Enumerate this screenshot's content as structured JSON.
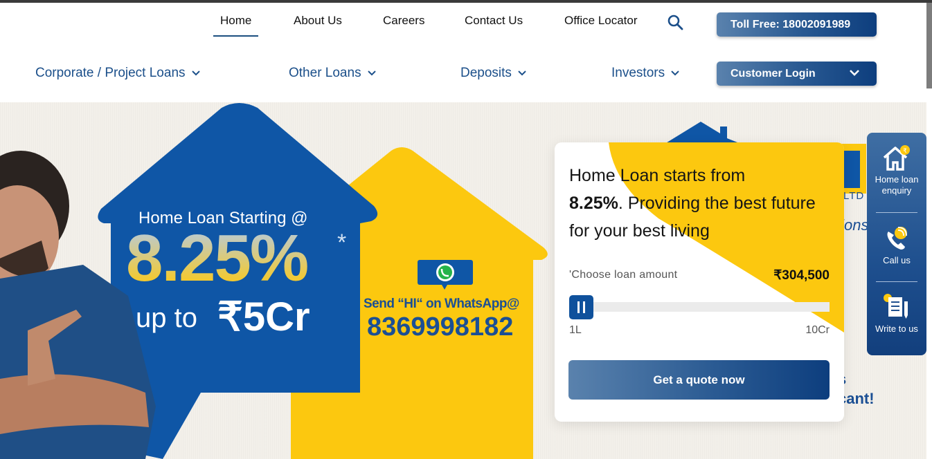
{
  "header": {
    "top_nav": [
      {
        "label": "Home",
        "active": true
      },
      {
        "label": "About Us",
        "active": false
      },
      {
        "label": "Careers",
        "active": false
      },
      {
        "label": "Contact Us",
        "active": false
      },
      {
        "label": "Office Locator",
        "active": false
      }
    ],
    "search_icon": "search-icon",
    "toll_free_label": "Toll Free: 18002091989",
    "main_nav": [
      {
        "label": "Corporate / Project Loans",
        "icon": "chevron-down-icon"
      },
      {
        "label": "Other Loans",
        "icon": "chevron-down-icon"
      },
      {
        "label": "Deposits",
        "icon": "chevron-down-icon"
      },
      {
        "label": "Investors",
        "icon": "chevron-down-icon"
      }
    ],
    "customer_login_label": "Customer Login"
  },
  "hero": {
    "headline": "Home Loan Starting @",
    "rate": "8.25%",
    "rate_footnote": "*",
    "upto_label": "up to",
    "upto_amount": "₹5Cr",
    "whatsapp_text": "Send “HI“ on WhatsApp@",
    "whatsapp_number": "8369998182",
    "brand_suffix": "LTD",
    "brand_tagline": "tionships",
    "bottom_line_1": "s",
    "bottom_line_2": "cant!",
    "colors": {
      "brand_blue": "#0f519c",
      "brand_yellow": "#fcc80f"
    }
  },
  "quote_card": {
    "title_prefix": "Home Loan starts from",
    "title_rate": "8.25%",
    "title_suffix": ". Providing the best future for your best living",
    "loan_label": "'Choose loan amount",
    "loan_value": "₹304,500",
    "slider": {
      "min_label": "1L",
      "max_label": "10Cr",
      "value": 304500,
      "min": 100000,
      "max": 100000000
    },
    "cta_label": "Get a quote now"
  },
  "side_panel": [
    {
      "label": "Home loan enquiry",
      "icon": "home-rupee-icon"
    },
    {
      "label": "Call us",
      "icon": "phone-icon"
    },
    {
      "label": "Write to us",
      "icon": "document-pen-icon"
    }
  ]
}
